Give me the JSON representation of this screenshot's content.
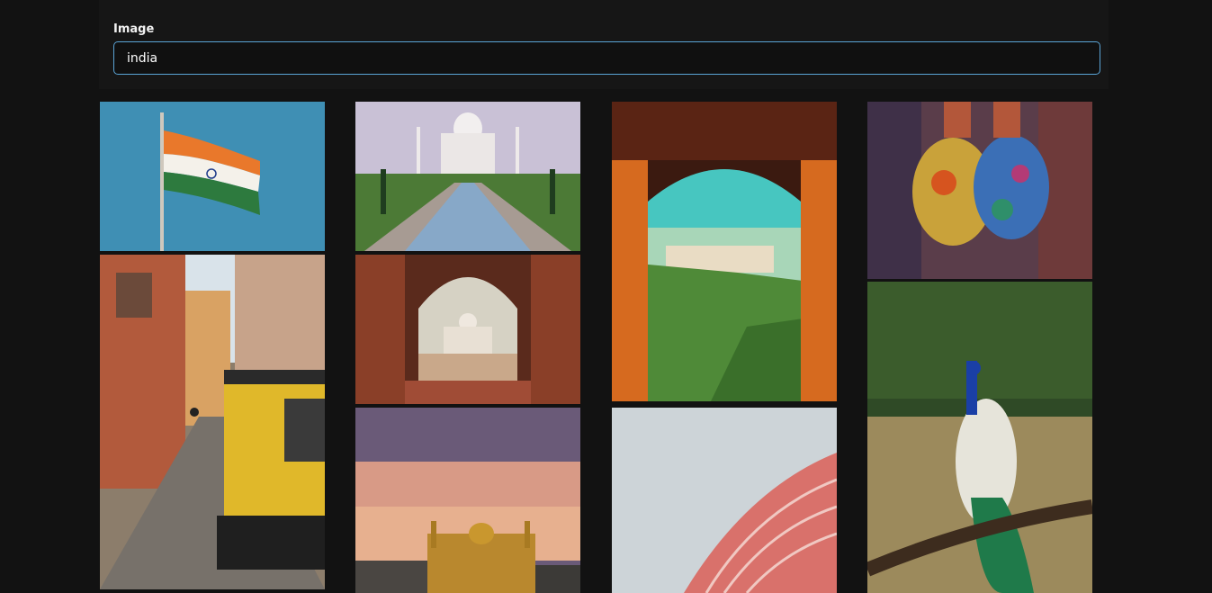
{
  "search": {
    "label": "Image",
    "value": "india",
    "accent_color": "#5aa4d6"
  },
  "gallery": {
    "columns": [
      {
        "images": [
          {
            "subject": "indian-flag"
          },
          {
            "subject": "street-auto-rickshaw"
          }
        ]
      },
      {
        "images": [
          {
            "subject": "taj-mahal-reflecting-pool"
          },
          {
            "subject": "taj-mahal-through-arch"
          },
          {
            "subject": "golden-temple-sunset"
          }
        ]
      },
      {
        "images": [
          {
            "subject": "fort-arch-view"
          },
          {
            "subject": "hawa-mahal-facade"
          }
        ]
      },
      {
        "images": [
          {
            "subject": "holi-colored-hands"
          },
          {
            "subject": "peacock"
          }
        ]
      }
    ]
  }
}
